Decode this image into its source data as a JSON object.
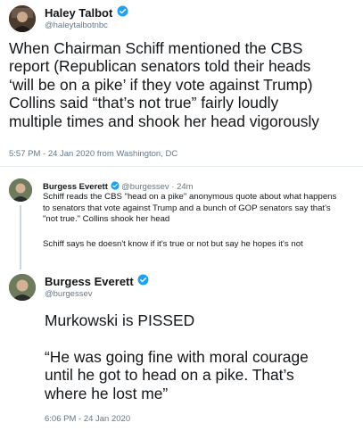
{
  "tweet1": {
    "name": "Haley Talbot",
    "handle": "@haleytalbotnbc",
    "text": "When Chairman Schiff mentioned the CBS\nreport (Republican senators told their heads\n‘will be on a pike’ if they vote against Trump)\nCollins said “that’s not true” fairly loudly\nmultiple times and shook her head vigorously",
    "timestamp": "5:57 PM - 24 Jan 2020 from Washington, DC"
  },
  "tweet2": {
    "name": "Burgess Everett",
    "handle": "@burgessev",
    "time": "· 24m",
    "text1": "Schiff reads the CBS \"head on a pike\" anonymous quote about what happens\nto senators that vote against Trump and a bunch of GOP senators say that's\n\"not true.\" Collins shook her head",
    "text2": "Schiff says he doesn't know if it's true or not but say he hopes it's not"
  },
  "tweet3": {
    "name": "Burgess Everett",
    "handle": "@burgessev",
    "text1": "Murkowski is PISSED",
    "text2": "“He was going fine with moral courage\nuntil he got to head on a pike. That’s\nwhere he lost me”",
    "timestamp": "6:06 PM - 24 Jan 2020"
  },
  "colors": {
    "verified": "#1da1f2",
    "secondary_text": "#657786",
    "divider": "#e1e8ed"
  }
}
